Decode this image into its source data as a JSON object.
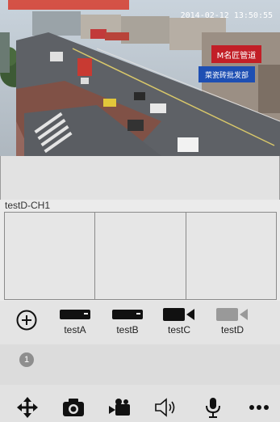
{
  "video": {
    "overlay_timestamp": "2014-02-12 13:50:55",
    "sign_top": "M名匠管道",
    "sign_bottom": "菜瓷砖批发部"
  },
  "channel_label": "testD-CH1",
  "devices": [
    {
      "label": "testA",
      "icon": "dvr-icon"
    },
    {
      "label": "testB",
      "icon": "dvr-icon"
    },
    {
      "label": "testC",
      "icon": "camera-icon"
    },
    {
      "label": "testD",
      "icon": "camera-icon"
    }
  ],
  "page_indicator": "1",
  "toolbar": [
    "ptz-move-icon",
    "snapshot-icon",
    "record-icon",
    "speaker-icon",
    "microphone-icon",
    "more-icon"
  ],
  "colors": {
    "accent": "#e8e8e8",
    "bg": "#ebebeb",
    "icon": "#111111"
  }
}
